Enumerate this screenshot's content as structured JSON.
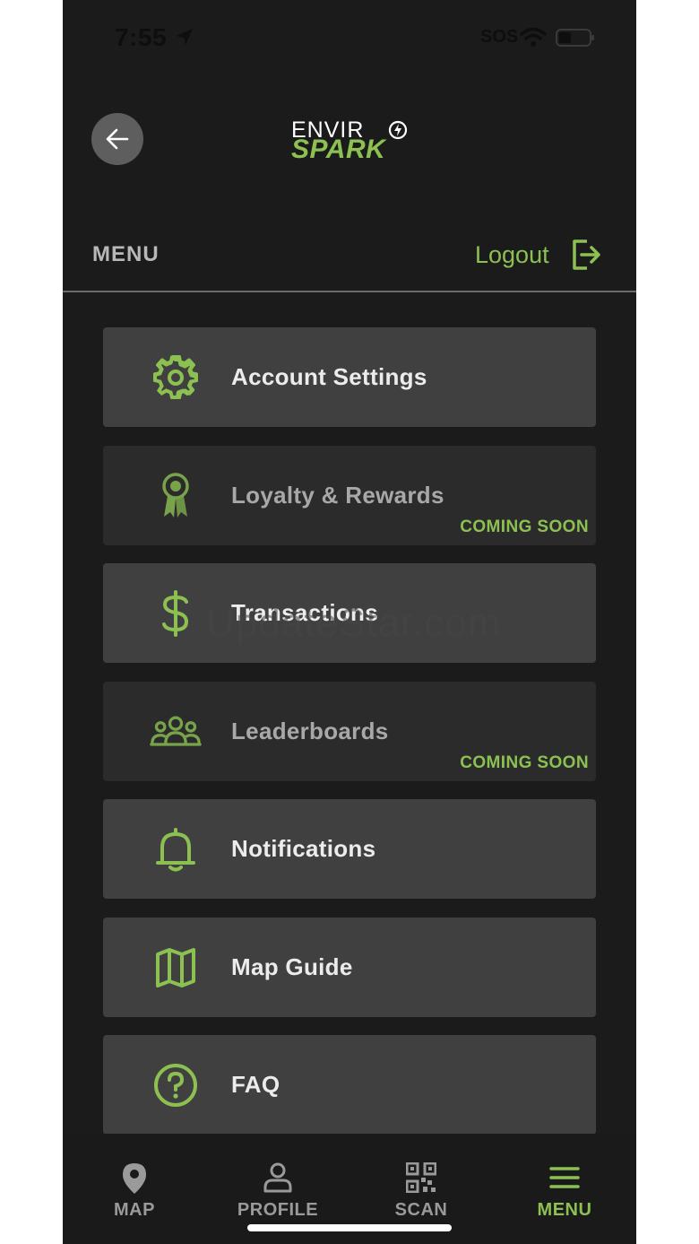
{
  "status_bar": {
    "time": "7:55",
    "carrier": "SOS"
  },
  "header": {
    "logo_top": "ENVIR",
    "logo_bottom": "SPARK",
    "menu_label": "MENU",
    "logout_label": "Logout"
  },
  "menu": {
    "items": [
      {
        "label": "Account Settings",
        "badge": "",
        "icon": "gear-icon"
      },
      {
        "label": "Loyalty & Rewards",
        "badge": "COMING SOON",
        "icon": "award-ribbon-icon"
      },
      {
        "label": "Transactions",
        "badge": "",
        "icon": "dollar-icon"
      },
      {
        "label": "Leaderboards",
        "badge": "COMING SOON",
        "icon": "users-group-icon"
      },
      {
        "label": "Notifications",
        "badge": "",
        "icon": "bell-icon"
      },
      {
        "label": "Map Guide",
        "badge": "",
        "icon": "map-icon"
      },
      {
        "label": "FAQ",
        "badge": "",
        "icon": "question-circle-icon"
      }
    ]
  },
  "watermark": "UpdateStar.com",
  "tabs": [
    {
      "label": "MAP",
      "icon": "location-pin-icon",
      "active": false
    },
    {
      "label": "PROFILE",
      "icon": "person-icon",
      "active": false
    },
    {
      "label": "SCAN",
      "icon": "qr-code-icon",
      "active": false
    },
    {
      "label": "MENU",
      "icon": "hamburger-icon",
      "active": true
    }
  ],
  "colors": {
    "accent": "#8cc152",
    "background": "#1b1b1b",
    "card": "#404040",
    "card_disabled": "#2b2b2b"
  }
}
